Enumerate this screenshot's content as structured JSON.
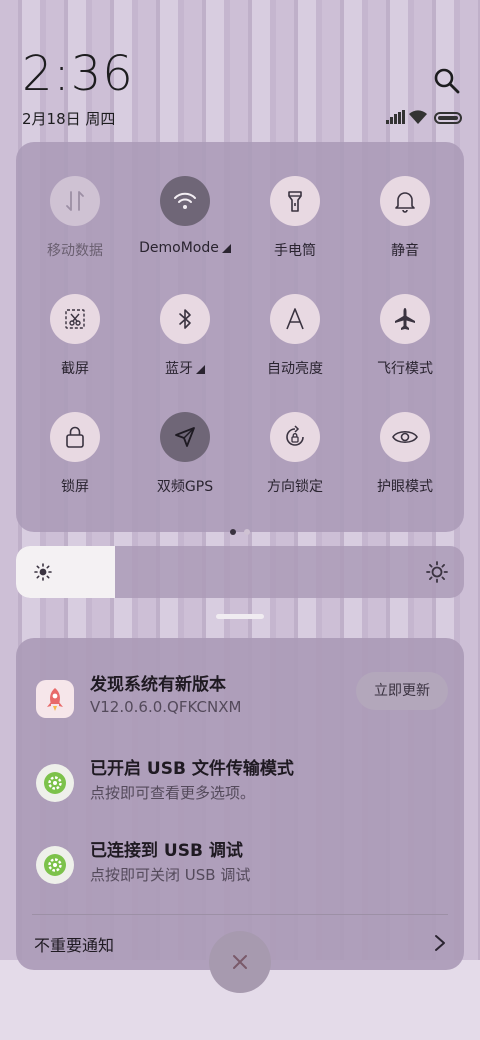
{
  "header": {
    "time": "2:36",
    "date": "2月18日 周四"
  },
  "control_center": {
    "toggles": [
      {
        "id": "mobile-data",
        "label": "移动数据",
        "icon": "updown-arrows-icon",
        "state": "disabled"
      },
      {
        "id": "wifi",
        "label": "DemoMode",
        "icon": "wifi-icon",
        "state": "on",
        "has_menu": true
      },
      {
        "id": "flashlight",
        "label": "手电筒",
        "icon": "flashlight-icon",
        "state": "off"
      },
      {
        "id": "silent",
        "label": "静音",
        "icon": "bell-icon",
        "state": "off"
      },
      {
        "id": "screenshot",
        "label": "截屏",
        "icon": "scissors-icon",
        "state": "off"
      },
      {
        "id": "bluetooth",
        "label": "蓝牙",
        "icon": "bluetooth-icon",
        "state": "off",
        "has_menu": true
      },
      {
        "id": "auto-brightness",
        "label": "自动亮度",
        "icon": "letter-a-icon",
        "state": "off"
      },
      {
        "id": "airplane",
        "label": "飞行模式",
        "icon": "airplane-icon",
        "state": "off"
      },
      {
        "id": "lock-screen",
        "label": "锁屏",
        "icon": "lock-icon",
        "state": "off"
      },
      {
        "id": "gps",
        "label": "双频GPS",
        "icon": "location-arrow-icon",
        "state": "on"
      },
      {
        "id": "rotation-lock",
        "label": "方向锁定",
        "icon": "rotation-lock-icon",
        "state": "off"
      },
      {
        "id": "eye-care",
        "label": "护眼模式",
        "icon": "eye-icon",
        "state": "off"
      }
    ],
    "page_count": 2,
    "current_page": 1
  },
  "brightness": {
    "level": 0.22
  },
  "notifications": [
    {
      "title": "发现系统有新版本",
      "subtitle": "V12.0.6.0.QFKCNXM",
      "icon": "system-update-icon",
      "action": "立即更新"
    },
    {
      "title": "已开启 USB 文件传输模式",
      "subtitle": "点按即可查看更多选项。",
      "icon": "android-settings-icon"
    },
    {
      "title": "已连接到 USB 调试",
      "subtitle": "点按即可关闭 USB 调试",
      "icon": "android-settings-icon"
    }
  ],
  "footer": {
    "unimportant_label": "不重要通知"
  },
  "colors": {
    "panel": "#ab9bb7",
    "active_toggle": "#6f6677",
    "inactive_toggle": "#e8d9e2"
  }
}
